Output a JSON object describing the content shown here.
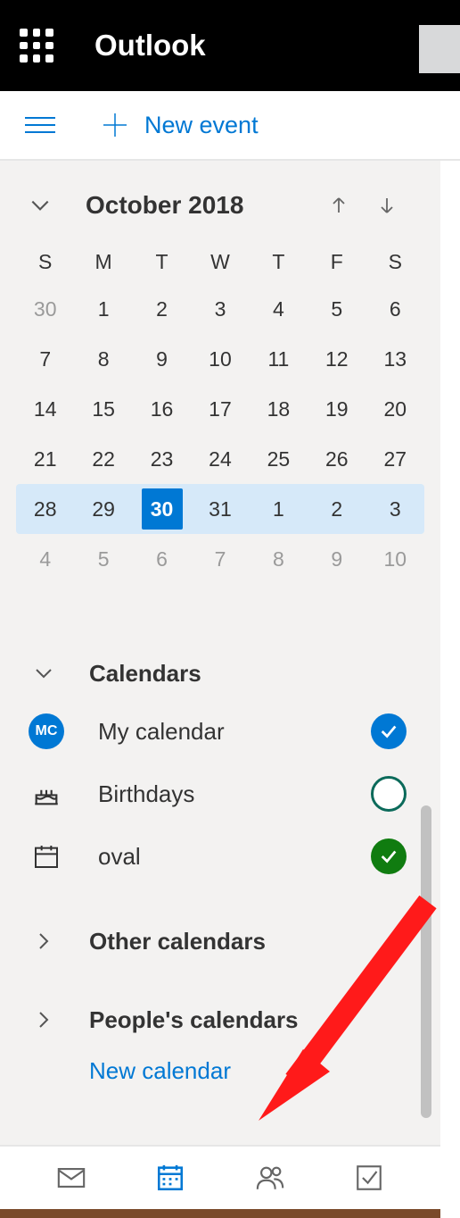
{
  "app": {
    "name": "Outlook"
  },
  "toolbar": {
    "new_event_label": "New event"
  },
  "datepicker": {
    "month_label": "October 2018",
    "day_headers": [
      "S",
      "M",
      "T",
      "W",
      "T",
      "F",
      "S"
    ],
    "weeks": [
      [
        {
          "n": "30",
          "dim": true
        },
        {
          "n": "1"
        },
        {
          "n": "2"
        },
        {
          "n": "3"
        },
        {
          "n": "4"
        },
        {
          "n": "5"
        },
        {
          "n": "6"
        }
      ],
      [
        {
          "n": "7"
        },
        {
          "n": "8"
        },
        {
          "n": "9"
        },
        {
          "n": "10"
        },
        {
          "n": "11"
        },
        {
          "n": "12"
        },
        {
          "n": "13"
        }
      ],
      [
        {
          "n": "14"
        },
        {
          "n": "15"
        },
        {
          "n": "16"
        },
        {
          "n": "17"
        },
        {
          "n": "18"
        },
        {
          "n": "19"
        },
        {
          "n": "20"
        }
      ],
      [
        {
          "n": "21"
        },
        {
          "n": "22"
        },
        {
          "n": "23"
        },
        {
          "n": "24"
        },
        {
          "n": "25"
        },
        {
          "n": "26"
        },
        {
          "n": "27"
        }
      ],
      [
        {
          "n": "28",
          "hl": true
        },
        {
          "n": "29",
          "hl": true
        },
        {
          "n": "30",
          "hl": true,
          "today": true
        },
        {
          "n": "31",
          "hl": true
        },
        {
          "n": "1",
          "hl": true
        },
        {
          "n": "2",
          "hl": true
        },
        {
          "n": "3",
          "hl": true
        }
      ],
      [
        {
          "n": "4",
          "dim": true
        },
        {
          "n": "5",
          "dim": true
        },
        {
          "n": "6",
          "dim": true
        },
        {
          "n": "7",
          "dim": true
        },
        {
          "n": "8",
          "dim": true
        },
        {
          "n": "9",
          "dim": true
        },
        {
          "n": "10",
          "dim": true
        }
      ]
    ]
  },
  "sections": {
    "calendars": {
      "label": "Calendars",
      "items": [
        {
          "name": "My calendar",
          "avatar_initials": "MC",
          "checked": true,
          "check_color": "blue"
        },
        {
          "name": "Birthdays",
          "icon": "cake-icon",
          "checked": false,
          "check_color": "empty"
        },
        {
          "name": "oval",
          "icon": "calendar-icon",
          "checked": true,
          "check_color": "green"
        }
      ]
    },
    "other": {
      "label": "Other calendars"
    },
    "people": {
      "label": "People's calendars"
    },
    "new_calendar_label": "New calendar"
  },
  "switcher": {
    "items": [
      "mail",
      "calendar",
      "people",
      "tasks"
    ],
    "active": "calendar"
  }
}
